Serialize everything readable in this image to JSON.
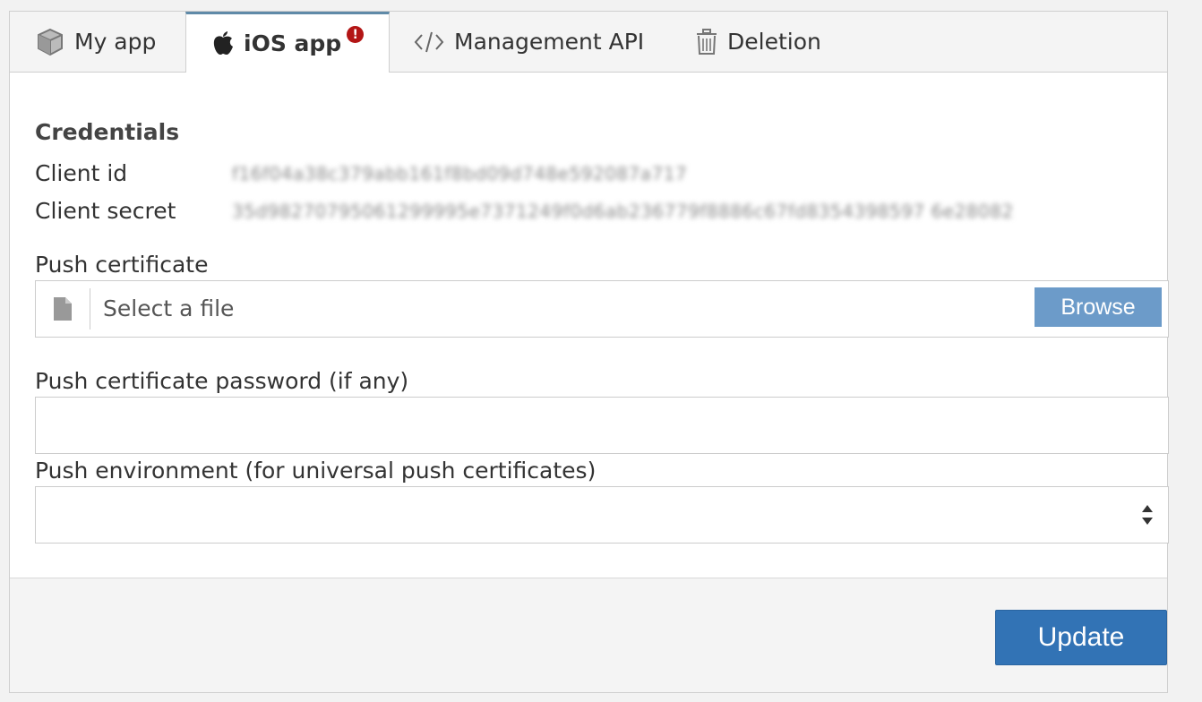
{
  "tabs": {
    "my_app": "My app",
    "ios_app": "iOS app",
    "ios_alert": "!",
    "management_api": "Management API",
    "deletion": "Deletion"
  },
  "credentials": {
    "title": "Credentials",
    "client_id_label": "Client id",
    "client_id_value": "f16f04a38c379abb161f8bd09d748e592087a717",
    "client_secret_label": "Client secret",
    "client_secret_value": "35d98270795061299995e7371249f0d6ab236779f8886c67fd8354398597 6e28082"
  },
  "push_certificate": {
    "label": "Push certificate",
    "placeholder": "Select a file",
    "browse_label": "Browse"
  },
  "push_password": {
    "label": "Push certificate password (if any)",
    "value": ""
  },
  "push_environment": {
    "label": "Push environment (for universal push certificates)",
    "value": ""
  },
  "footer": {
    "update_label": "Update"
  },
  "colors": {
    "active_tab_accent": "#5f8aa8",
    "alert": "#b31515",
    "browse": "#6c9bc9",
    "primary": "#3273b5"
  }
}
